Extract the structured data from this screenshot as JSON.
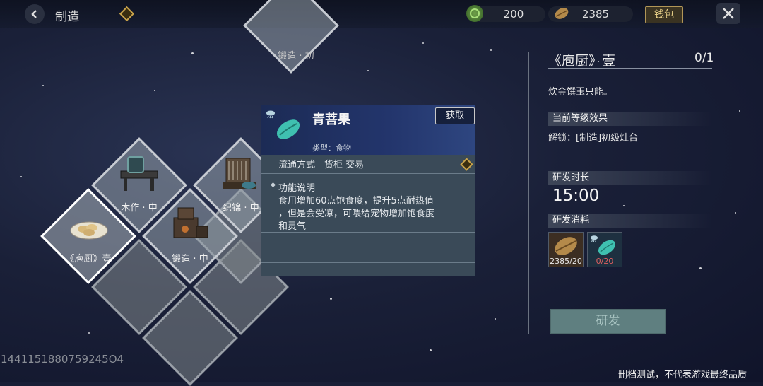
{
  "topbar": {
    "title": "制造",
    "currency_jade": "200",
    "currency_seed": "2385",
    "wallet_label": "钱包"
  },
  "tiles": {
    "forge_basic": "锻造 · 初",
    "woodwork": "木作 · 中",
    "weaving": "织锦 · 中",
    "kitchen": "《庖厨》壹",
    "forge_mid": "锻造 · 中"
  },
  "popup": {
    "name": "青菩果",
    "obtain_label": "获取",
    "type": "类型：食物",
    "circulation": "流通方式　货柜 交易",
    "function_title": "功能说明",
    "function_desc_1": "食用增加60点饱食度，提升5点耐热值",
    "function_desc_2": "，但是会受凉，可喂给宠物增加饱食度",
    "function_desc_3": "和灵气"
  },
  "right_panel": {
    "title": "《庖厨》壹",
    "count": "0/1",
    "desc": "炊金馔玉只能。",
    "current_effect_header": "当前等级效果",
    "unlock_text": "解锁：[制造]初级灶台",
    "duration_header": "研发时长",
    "duration": "15:00",
    "cost_header": "研发消耗",
    "costs": [
      {
        "icon": "seed-icon",
        "amount": "2385/20",
        "color": "#e8e8e8"
      },
      {
        "icon": "green-fruit-icon",
        "amount": "0/20",
        "color": "#e06060"
      }
    ],
    "research_label": "研发"
  },
  "footer": {
    "uid": "1441151880759245O4",
    "disclaimer": "删档测试，不代表游戏最终品质"
  }
}
